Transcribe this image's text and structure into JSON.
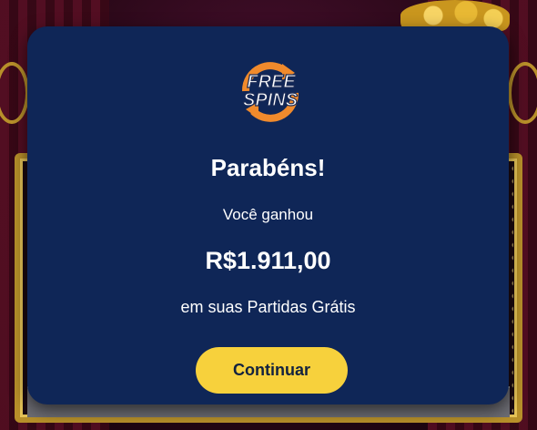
{
  "background": {
    "description_colors": {
      "curtain": "#5a0f24",
      "frame_gold": "#b8902a"
    }
  },
  "modal": {
    "logo": {
      "line1": "FREE",
      "line2": "SPINS",
      "icon": "free-spins-logo-icon"
    },
    "title": "Parabéns!",
    "subtitle": "Você ganhou",
    "amount": "R$1.911,00",
    "note": "em suas Partidas Grátis",
    "continue_label": "Continuar",
    "colors": {
      "panel": "#0f2657",
      "button": "#f7d13c",
      "button_text": "#12223f",
      "logo_arrow": "#f08a2c"
    }
  }
}
